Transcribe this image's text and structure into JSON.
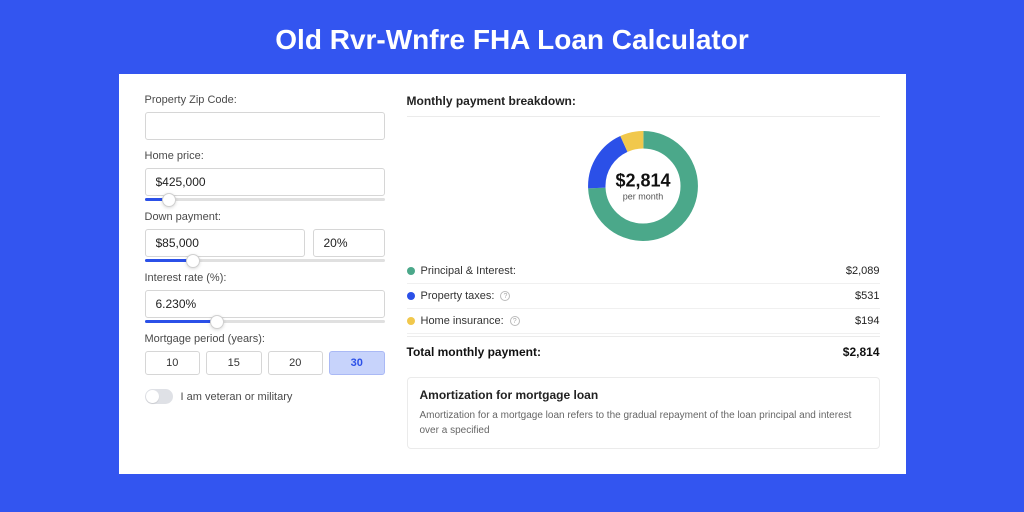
{
  "title": "Old Rvr-Wnfre FHA Loan Calculator",
  "form": {
    "zip_label": "Property Zip Code:",
    "zip_value": "",
    "home_price_label": "Home price:",
    "home_price_value": "$425,000",
    "home_price_slider_pct": 10,
    "down_payment_label": "Down payment:",
    "down_payment_value": "$85,000",
    "down_payment_pct": "20%",
    "down_payment_slider_pct": 20,
    "interest_label": "Interest rate (%):",
    "interest_value": "6.230%",
    "interest_slider_pct": 30,
    "period_label": "Mortgage period (years):",
    "periods": [
      "10",
      "15",
      "20",
      "30"
    ],
    "period_active_index": 3,
    "veteran_label": "I am veteran or military"
  },
  "breakdown": {
    "title": "Monthly payment breakdown:",
    "center_amount": "$2,814",
    "center_sub": "per month",
    "rows": [
      {
        "label": "Principal & Interest:",
        "value": "$2,089",
        "color": "#4ba88a",
        "info": false
      },
      {
        "label": "Property taxes:",
        "value": "$531",
        "color": "#2b50e8",
        "info": true
      },
      {
        "label": "Home insurance:",
        "value": "$194",
        "color": "#f1c84c",
        "info": true
      }
    ],
    "total_label": "Total monthly payment:",
    "total_value": "$2,814"
  },
  "amort": {
    "title": "Amortization for mortgage loan",
    "body": "Amortization for a mortgage loan refers to the gradual repayment of the loan principal and interest over a specified"
  },
  "chart_data": {
    "type": "pie",
    "title": "Monthly payment breakdown",
    "series": [
      {
        "name": "Principal & Interest",
        "value": 2089,
        "color": "#4ba88a"
      },
      {
        "name": "Property taxes",
        "value": 531,
        "color": "#2b50e8"
      },
      {
        "name": "Home insurance",
        "value": 194,
        "color": "#f1c84c"
      }
    ],
    "total": 2814,
    "unit": "USD per month"
  }
}
